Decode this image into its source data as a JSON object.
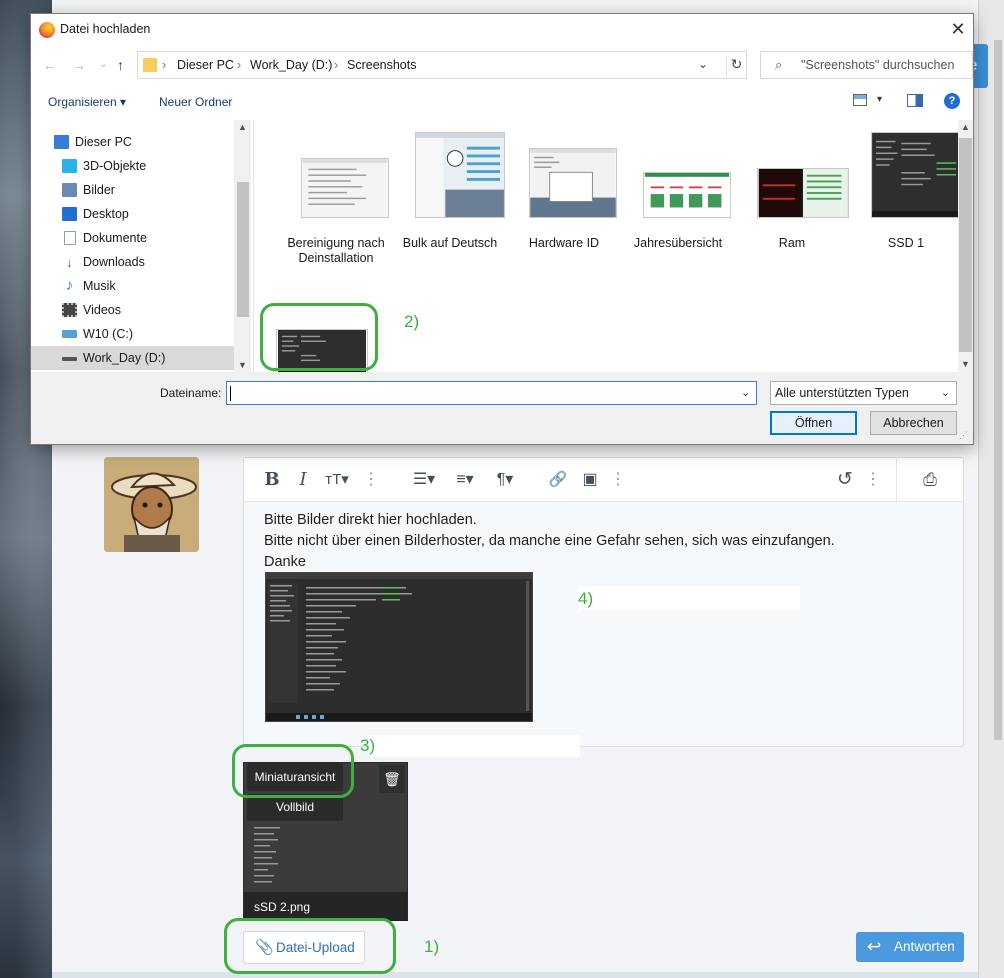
{
  "dialog": {
    "title": "Datei hochladen",
    "close": "✕",
    "nav": {
      "back": "←",
      "forward": "→",
      "recent": "⌄",
      "up": "↑"
    },
    "address": {
      "lead_sep": "›",
      "segments": [
        "Dieser PC",
        "Work_Day (D:)",
        "Screenshots"
      ],
      "sep": "›",
      "chevron": "⌄",
      "refresh": "↻"
    },
    "search_placeholder": "\"Screenshots\" durchsuchen",
    "search_icon": "⌕",
    "commands": {
      "organize": "Organisieren ▾",
      "new_folder": "Neuer Ordner",
      "view_chevron": "▾",
      "help": "?"
    },
    "nav_pane": [
      {
        "label": "Dieser PC",
        "icon": "computer-icon",
        "color": "#3a7bd5"
      },
      {
        "label": "3D-Objekte",
        "icon": "cube-icon",
        "color": "#2bb2e8"
      },
      {
        "label": "Bilder",
        "icon": "pictures-icon",
        "color": "#6a88b0"
      },
      {
        "label": "Desktop",
        "icon": "desktop-icon",
        "color": "#1f6fd0"
      },
      {
        "label": "Dokumente",
        "icon": "documents-icon",
        "color": "#8a9aaf"
      },
      {
        "label": "Downloads",
        "icon": "download-icon",
        "color": "#2a7fd4"
      },
      {
        "label": "Musik",
        "icon": "music-icon",
        "color": "#1f7fd8"
      },
      {
        "label": "Videos",
        "icon": "video-icon",
        "color": "#444444"
      },
      {
        "label": "W10 (C:)",
        "icon": "drive-c-icon",
        "color": "#5aa0d8"
      },
      {
        "label": "Work_Day (D:)",
        "icon": "drive-d-icon",
        "color": "#555555"
      }
    ],
    "files": [
      {
        "label": "Bereinigung nach Deinstallation",
        "theme": "light"
      },
      {
        "label": "Bulk auf Deutsch",
        "theme": "light"
      },
      {
        "label": "Hardware ID",
        "theme": "light"
      },
      {
        "label": "Jahresübersicht",
        "theme": "light"
      },
      {
        "label": "Ram",
        "theme": "dark-red"
      },
      {
        "label": "SSD 1",
        "theme": "dark"
      },
      {
        "label": "",
        "theme": "dark"
      }
    ],
    "scroll_arrows": {
      "up": "▲",
      "down": "▼"
    },
    "filename_label": "Dateiname:",
    "filename_value": "",
    "filetype": "Alle unterstützten Typen",
    "select_chevron": "⌄",
    "open": "Öffnen",
    "cancel": "Abbrechen",
    "grip": "⋰"
  },
  "editor": {
    "toolbar": {
      "bold": "B",
      "italic": "I",
      "text_size": "тT▾",
      "more1": "⋮",
      "list": "☰▾",
      "align": "≡▾",
      "paragraph": "¶▾",
      "link": "🔗",
      "image": "▣",
      "more2": "⋮",
      "undo": "↺",
      "more3": "⋮",
      "preview": "⎙"
    },
    "lines": [
      "Bitte Bilder direkt hier hochladen.",
      "Bitte nicht über einen Bilderhoster, da manche eine Gefahr sehen, sich was einzufangen.",
      "Danke"
    ]
  },
  "attachment": {
    "filename": "sSD 2.png",
    "option_thumbnail": "Miniaturansicht",
    "option_full": "Vollbild",
    "delete_icon": "🗑"
  },
  "buttons": {
    "upload": "Datei-Upload",
    "upload_icon": "📎",
    "reply": "Antworten",
    "reply_icon": "↩"
  },
  "page": {
    "right_edge_letter": "e"
  },
  "annotations": [
    "1)",
    "2)",
    "3)",
    "4)"
  ],
  "colors": {
    "annotation": "#3fb03f",
    "accent": "#4b9ae0",
    "dialog_focus": "#0078d7"
  }
}
